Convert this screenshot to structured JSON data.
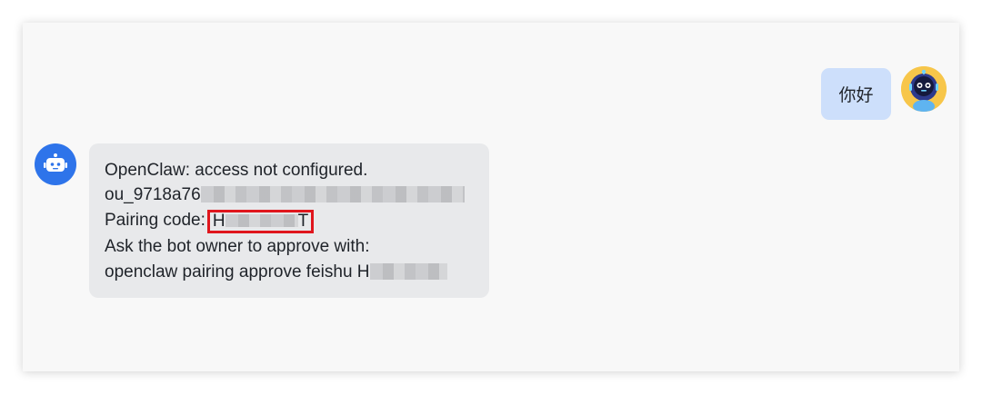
{
  "conversation": {
    "user_message": {
      "text": "你好",
      "avatar_icon": "robot-mascot-avatar",
      "bubble_color": "#cddffb"
    },
    "bot_message": {
      "avatar_icon": "robot-icon",
      "avatar_color": "#2e74ea",
      "line1": "OpenClaw: access not configured.",
      "line2_prefix": "ou_9718a76",
      "line3_prefix": "Pairing code:",
      "code_start": "H",
      "code_end": "T",
      "line4": "Ask the bot owner to approve with:",
      "line5_prefix": "openclaw pairing approve feishu H",
      "highlight_color": "#e0161d"
    }
  }
}
